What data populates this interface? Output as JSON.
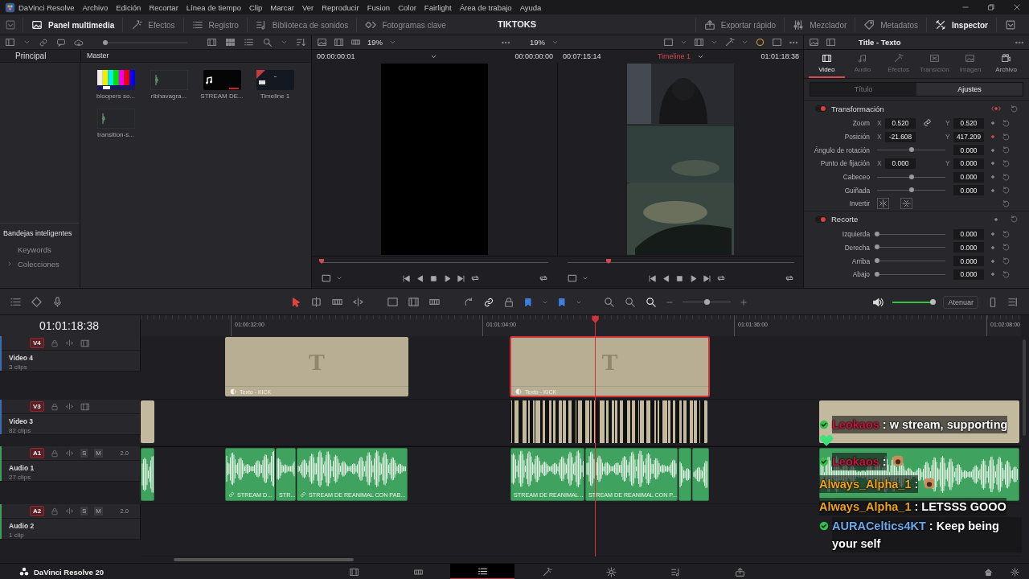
{
  "app": {
    "title": "DaVinci Resolve",
    "product": "DaVinci Resolve 20"
  },
  "menu": [
    "Archivo",
    "Edición",
    "Recortar",
    "Línea de tiempo",
    "Clip",
    "Marcar",
    "Ver",
    "Reproducir",
    "Fusion",
    "Color",
    "Fairlight",
    "Área de trabajo",
    "Ayuda"
  ],
  "toolbar": {
    "left": [
      {
        "label": "Panel multimedia",
        "on": true
      },
      {
        "label": "Efectos",
        "on": false
      },
      {
        "label": "Registro",
        "on": false
      },
      {
        "label": "Biblioteca de sonidos",
        "on": false
      },
      {
        "label": "Fotogramas clave",
        "on": false
      }
    ],
    "project": "TIKTOKS",
    "right": [
      {
        "label": "Exportar rápido",
        "on": false
      },
      {
        "label": "Mezclador",
        "on": false
      },
      {
        "label": "Metadatos",
        "on": false
      },
      {
        "label": "Inspector",
        "on": true
      }
    ]
  },
  "media_pool": {
    "bins_title": "Principal",
    "bin": "Master",
    "thumbnail_size": {
      "level": 0.0
    },
    "clips": [
      {
        "name": "bloopers so...",
        "kind": "bars"
      },
      {
        "name": "ribhavagra...",
        "kind": "audio"
      },
      {
        "name": "STREAM DE...",
        "kind": "music"
      },
      {
        "name": "Timeline 1",
        "kind": "timeline"
      },
      {
        "name": "transition-s...",
        "kind": "audio"
      }
    ],
    "smart_bins": {
      "title": "Bandejas inteligentes",
      "items": [
        {
          "label": "Keywords",
          "expandable": false
        },
        {
          "label": "Colecciones",
          "expandable": true
        }
      ]
    }
  },
  "source_viewer": {
    "zoom": "19%",
    "duration": "00:00:00:01",
    "timecode": "00:00:00:00",
    "scrub": {
      "level": 0.0
    }
  },
  "timeline_viewer": {
    "zoom": "19%",
    "duration": "00:07:15:14",
    "timeline": "Timeline 1",
    "timecode": "01:01:18:38",
    "scrub": {
      "level": 0.18
    }
  },
  "inspector": {
    "title": "Title - Texto",
    "tabs": [
      {
        "label": "Video",
        "selected": true,
        "disabled": false
      },
      {
        "label": "Audio",
        "selected": false,
        "disabled": true
      },
      {
        "label": "Efectos",
        "selected": false,
        "disabled": true
      },
      {
        "label": "Transición",
        "selected": false,
        "disabled": true
      },
      {
        "label": "Imagen",
        "selected": false,
        "disabled": true
      },
      {
        "label": "Archivo",
        "selected": false,
        "disabled": false
      }
    ],
    "subtabs": [
      {
        "label": "Título",
        "selected": false
      },
      {
        "label": "Ajustes",
        "selected": true
      }
    ],
    "sections": [
      {
        "title": "Transformación",
        "enabled": true,
        "keyframed": true,
        "rows": [
          {
            "kind": "xy",
            "label": "Zoom",
            "x": {
              "axis": "X",
              "value": "0.520"
            },
            "y": {
              "axis": "Y",
              "value": "0.520"
            },
            "linked": true,
            "keyframed": false
          },
          {
            "kind": "xy",
            "label": "Posición",
            "x": {
              "axis": "X",
              "value": "-21.608"
            },
            "y": {
              "axis": "Y",
              "value": "417.209"
            },
            "linked": false,
            "keyframed": true
          },
          {
            "kind": "slider",
            "label": "Ángulo de rotación",
            "level": 0.5,
            "value": "0.000",
            "keyframed": false
          },
          {
            "kind": "xy",
            "label": "Punto de fijación",
            "x": {
              "axis": "X",
              "value": "0.000"
            },
            "y": {
              "axis": "Y",
              "value": "0.000"
            },
            "linked": false,
            "keyframed": false
          },
          {
            "kind": "slider",
            "label": "Cabeceo",
            "level": 0.5,
            "value": "0.000",
            "keyframed": false
          },
          {
            "kind": "slider",
            "label": "Guiñada",
            "level": 0.5,
            "value": "0.000",
            "keyframed": false
          },
          {
            "kind": "flip",
            "label": "Invertir"
          }
        ]
      },
      {
        "title": "Recorte",
        "enabled": true,
        "keyframed": false,
        "rows": [
          {
            "kind": "slider",
            "label": "Izquierda",
            "level": 0,
            "value": "0.000",
            "keyframed": false
          },
          {
            "kind": "slider",
            "label": "Derecha",
            "level": 0,
            "value": "0.000",
            "keyframed": false
          },
          {
            "kind": "slider",
            "label": "Arriba",
            "level": 0,
            "value": "0.000",
            "keyframed": false
          },
          {
            "kind": "slider",
            "label": "Abajo",
            "level": 0,
            "value": "0.000",
            "keyframed": false
          }
        ]
      }
    ]
  },
  "timeline": {
    "timecode": "01:01:18:38",
    "ruler": [
      "01:00:32:00",
      "01:01:04:00",
      "01:01:36:00",
      "01:02:08:00"
    ],
    "zoom": {
      "level": 0.5
    },
    "volume": {
      "level": 0.95
    },
    "attenuate": "Atenuar",
    "tracks": [
      {
        "id": "V4",
        "name": "Video 4",
        "count": "3 clips",
        "kind": "video",
        "clips": [
          {
            "kind": "title",
            "glyph": "T",
            "label": "Texto - KICK",
            "selected": false
          },
          {
            "kind": "title",
            "glyph": "T",
            "label": "Texto - KICK",
            "selected": true
          }
        ]
      },
      {
        "id": "V3",
        "name": "Video 3",
        "count": "82 clips",
        "kind": "video",
        "clips": [
          {
            "kind": "plain",
            "selected": false
          },
          {
            "kind": "strips",
            "selected": false
          },
          {
            "kind": "plain",
            "selected": false
          }
        ]
      },
      {
        "id": "A1",
        "name": "Audio 1",
        "count": "27 clips",
        "kind": "audio",
        "buttons": [
          "S",
          "M"
        ],
        "channels": "2.0",
        "clips": [
          {
            "kind": "audio",
            "selected": false
          },
          {
            "kind": "audio",
            "label": "STREAM D...",
            "linked": true,
            "selected": false
          },
          {
            "kind": "audio",
            "label": "STR...",
            "linked": false,
            "selected": false
          },
          {
            "kind": "audio",
            "label": "STREAM DE REANIMAL CON PAB...",
            "linked": true,
            "selected": false
          },
          {
            "kind": "audio",
            "label": "STREAM DE REANIMAL ...",
            "linked": false,
            "selected": false
          },
          {
            "kind": "audio",
            "label": "STREAM DE REANIMAL CON P...",
            "linked": false,
            "selected": false
          },
          {
            "kind": "audio",
            "selected": false
          },
          {
            "kind": "audio",
            "selected": false
          },
          {
            "kind": "audio",
            "selected": false
          }
        ]
      },
      {
        "id": "A2",
        "name": "Audio 2",
        "count": "1 clip",
        "kind": "audio",
        "buttons": [
          "S",
          "M"
        ],
        "channels": "2.0"
      }
    ]
  },
  "pages": [
    {
      "selected": false
    },
    {
      "selected": false
    },
    {
      "selected": true
    },
    {
      "selected": false
    },
    {
      "selected": false
    },
    {
      "selected": false
    },
    {
      "selected": false
    }
  ],
  "chat": [
    {
      "user": "Leokaos",
      "message": ": w stream, supporting",
      "verified": true,
      "color": "#c8143c",
      "kind": "heart"
    },
    {
      "user": "Leokaos",
      "message": ":",
      "verified": true,
      "color": "#c8143c",
      "kind": "emote"
    },
    {
      "user": "Always_Alpha_1",
      "message": ":",
      "verified": false,
      "color": "#f0a418",
      "kind": "emote"
    },
    {
      "user": "Always_Alpha_1",
      "message": ": LETSSS GOOO",
      "verified": false,
      "color": "#f0a418",
      "kind": "plain"
    },
    {
      "user": "AURACeltics4KT",
      "message": ": Keep being your self",
      "verified": true,
      "color": "#6aa8ee",
      "kind": "plain"
    }
  ]
}
